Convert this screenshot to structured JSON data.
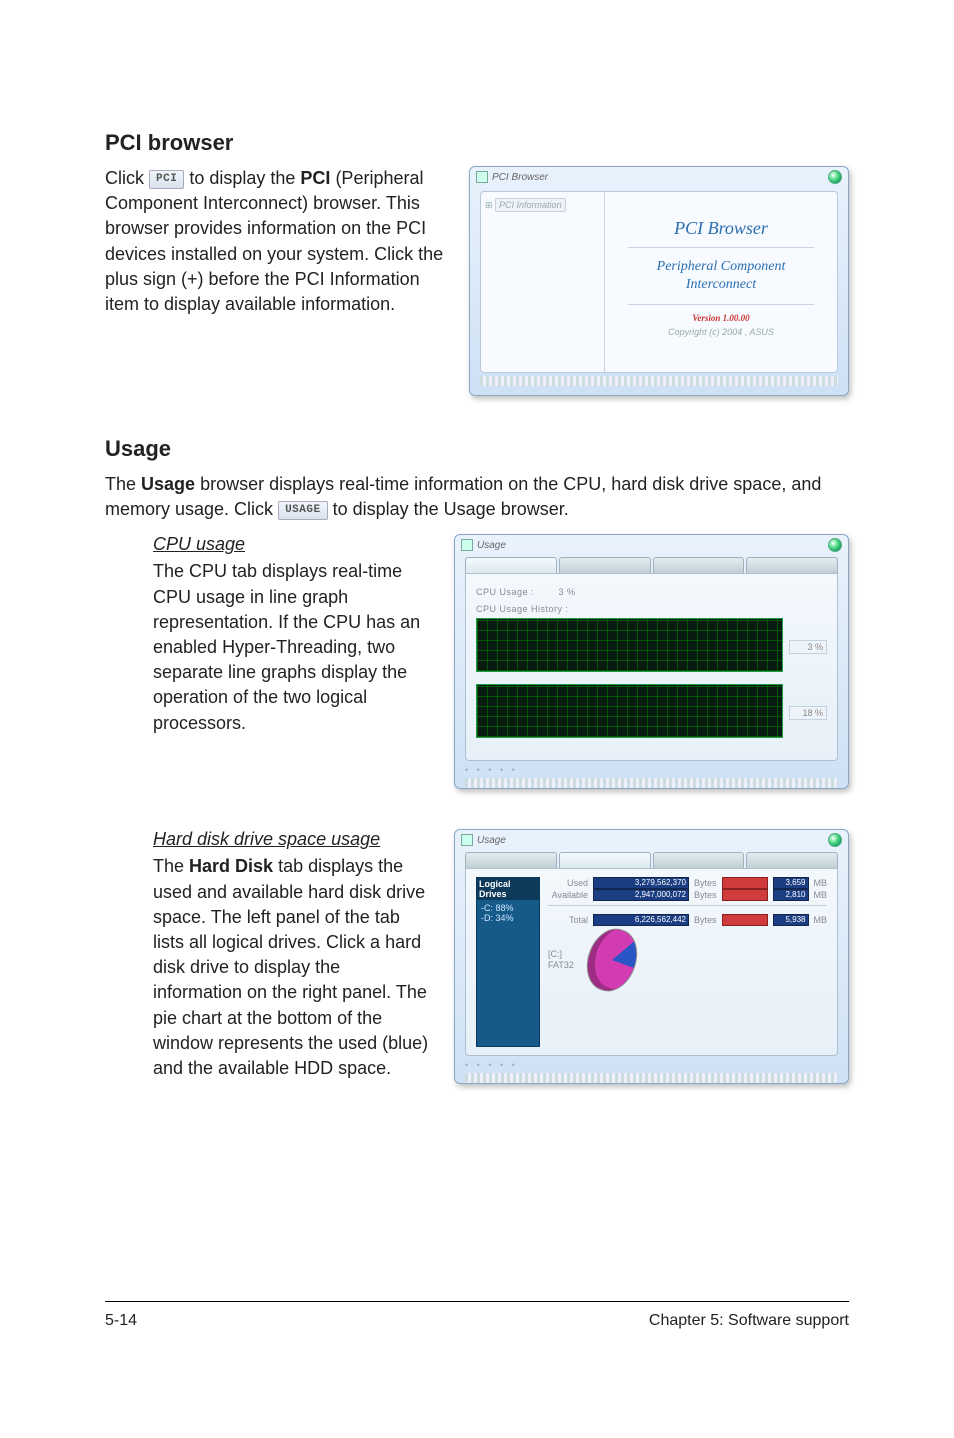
{
  "sections": {
    "pci": {
      "heading": "PCI browser",
      "paragraph_parts": {
        "pre": "Click ",
        "chip": "PCI",
        "mid": " to display the ",
        "bold": "PCI",
        "post": " (Peripheral Component Interconnect) browser. This browser provides information on the PCI devices installed on your system. Click the plus sign (+) before the PCI Information item to display available information."
      }
    },
    "usage": {
      "heading": "Usage",
      "intro_parts": {
        "pre": "The ",
        "bold1": "Usage",
        "mid": " browser displays real-time information on the CPU, hard disk drive space, and memory usage. Click ",
        "chip": "USAGE",
        "post": " to display the Usage browser."
      },
      "cpu": {
        "subtitle": "CPU usage",
        "body": "The CPU tab displays real-time CPU usage in line graph representation. If the CPU has an enabled Hyper-Threading, two separate line graphs display the operation of the two logical processors."
      },
      "hdd": {
        "subtitle": "Hard disk drive space usage",
        "body_parts": {
          "pre": "The ",
          "bold": "Hard Disk",
          "post": " tab displays the used and available hard disk drive space. The left panel of the tab lists all logical drives. Click a hard disk drive to display the information on the right panel. The pie chart at the bottom of the window represents the used (blue) and the available HDD space."
        }
      }
    }
  },
  "mock": {
    "pci_window": {
      "title": "PCI Browser",
      "tree_item": "PCI Information",
      "panel_title": "PCI Browser",
      "panel_sub1": "Peripheral Component",
      "panel_sub2": "Interconnect",
      "version": "Version 1.00.00",
      "copyright": "Copyright (c) 2004 , ASUS"
    },
    "usage_window": {
      "title": "Usage",
      "cpu_label1": "CPU Usage :",
      "cpu_value1": "3 %",
      "cpu_label2": "CPU Usage History :",
      "pct_top": "3 %",
      "pct_bot": "18 %"
    },
    "hdd_window": {
      "title": "Usage",
      "side_header": "Logical Drives",
      "side_items": [
        "-C: 88%",
        "-D: 34%"
      ],
      "rows": {
        "used": {
          "label": "Used",
          "bar1": "3,279,562,370",
          "unit1": "Bytes",
          "bar2": "3,659",
          "unit2": "MB"
        },
        "avail": {
          "label": "Available",
          "bar1": "2,947,000,072",
          "unit1": "Bytes",
          "bar2": "2,810",
          "unit2": "MB"
        },
        "total": {
          "label": "Total",
          "bar1": "6,226,562,442",
          "unit1": "Bytes",
          "bar2": "5,938",
          "unit2": "MB"
        }
      },
      "pie_label1": "[C:]",
      "pie_label2": "FAT32"
    }
  },
  "footer": {
    "left": "5-14",
    "right": "Chapter 5: Software support"
  }
}
